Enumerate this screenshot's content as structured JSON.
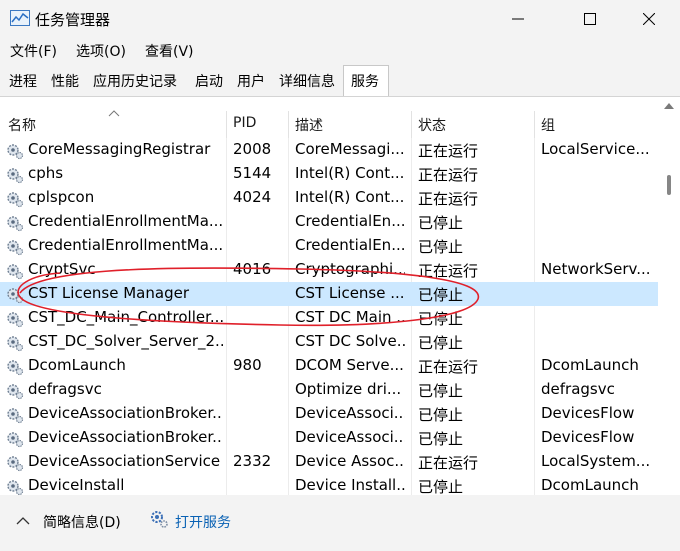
{
  "window": {
    "title": "任务管理器",
    "min_glyph": "—",
    "max_glyph": "☐",
    "close_glyph": "✕",
    "icon": "task-manager-icon"
  },
  "menubar": {
    "items": [
      "文件(F)",
      "选项(O)",
      "查看(V)"
    ]
  },
  "tabs": {
    "items": [
      "进程",
      "性能",
      "应用历史记录",
      "启动",
      "用户",
      "详细信息",
      "服务"
    ],
    "selected": "服务"
  },
  "table": {
    "columns": [
      "名称",
      "PID",
      "描述",
      "状态",
      "组"
    ],
    "rows": [
      {
        "name": "CoreMessagingRegistrar",
        "pid": "2008",
        "desc": "CoreMessagi...",
        "status": "正在运行",
        "group": "LocalService..."
      },
      {
        "name": "cphs",
        "pid": "5144",
        "desc": "Intel(R) Cont...",
        "status": "正在运行",
        "group": ""
      },
      {
        "name": "cplspcon",
        "pid": "4024",
        "desc": "Intel(R) Cont...",
        "status": "正在运行",
        "group": ""
      },
      {
        "name": "CredentialEnrollmentMa...",
        "pid": "",
        "desc": "CredentialEn...",
        "status": "已停止",
        "group": ""
      },
      {
        "name": "CredentialEnrollmentMa...",
        "pid": "",
        "desc": "CredentialEn...",
        "status": "已停止",
        "group": ""
      },
      {
        "name": "CryptSvc",
        "pid": "4016",
        "desc": "Cryptographi...",
        "status": "正在运行",
        "group": "NetworkServ..."
      },
      {
        "name": "CST License Manager",
        "pid": "",
        "desc": "CST License ...",
        "status": "已停止",
        "group": ""
      },
      {
        "name": "CST_DC_Main_Controller...",
        "pid": "",
        "desc": "CST DC Main ...",
        "status": "已停止",
        "group": ""
      },
      {
        "name": "CST_DC_Solver_Server_2...",
        "pid": "",
        "desc": "CST DC Solve...",
        "status": "已停止",
        "group": ""
      },
      {
        "name": "DcomLaunch",
        "pid": "980",
        "desc": "DCOM Serve...",
        "status": "正在运行",
        "group": "DcomLaunch"
      },
      {
        "name": "defragsvc",
        "pid": "",
        "desc": "Optimize dri...",
        "status": "已停止",
        "group": "defragsvc"
      },
      {
        "name": "DeviceAssociationBroker...",
        "pid": "",
        "desc": "DeviceAssoci...",
        "status": "已停止",
        "group": "DevicesFlow"
      },
      {
        "name": "DeviceAssociationBroker...",
        "pid": "",
        "desc": "DeviceAssoci...",
        "status": "已停止",
        "group": "DevicesFlow"
      },
      {
        "name": "DeviceAssociationService",
        "pid": "2332",
        "desc": "Device Assoc...",
        "status": "正在运行",
        "group": "LocalSystem..."
      },
      {
        "name": "DeviceInstall",
        "pid": "",
        "desc": "Device Install...",
        "status": "已停止",
        "group": "DcomLaunch"
      }
    ],
    "selected_row": "CST License Manager",
    "row_icon": "service-gear-icon",
    "selected_color": "#cce8ff"
  },
  "annotation": {
    "shape": "ellipse",
    "color": "#e0202a"
  },
  "footer": {
    "collapse_label": "简略信息(D)",
    "open_services_label": "打开服务",
    "link_color": "#0a62b4"
  }
}
